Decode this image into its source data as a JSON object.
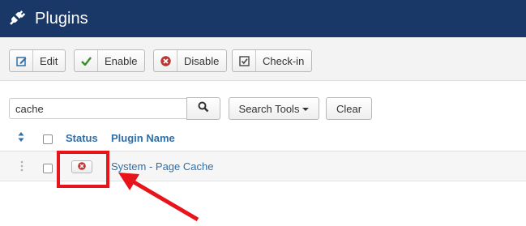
{
  "header": {
    "title": "Plugins",
    "icon": "plug-icon",
    "background": "#1a3867"
  },
  "toolbar": {
    "edit_label": "Edit",
    "enable_label": "Enable",
    "disable_label": "Disable",
    "checkin_label": "Check-in"
  },
  "search": {
    "value": "cache",
    "search_tools_label": "Search Tools",
    "clear_label": "Clear"
  },
  "table": {
    "columns": {
      "status": "Status",
      "plugin_name": "Plugin Name"
    },
    "rows": [
      {
        "status": "disabled",
        "name": "System - Page Cache"
      }
    ]
  },
  "annotation": {
    "color": "#e8141c"
  }
}
